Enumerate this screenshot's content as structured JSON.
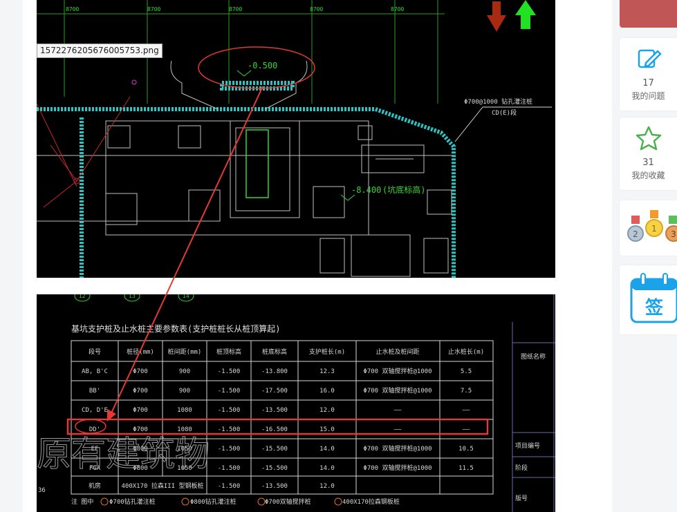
{
  "tooltip": {
    "filename": "1572276205676005753.png"
  },
  "drawing_top": {
    "axis_labels": [
      "8700",
      "8700",
      "8700",
      "8700",
      "8700"
    ],
    "elevation_1": "-0.500",
    "elevation_2": "-8.400",
    "elevation_2_note": "(坑底标高)",
    "pile_note_1": "Φ700@1000 钻孔灌注桩",
    "pile_note_2": "CD(E)段",
    "grid_tags": [
      "12",
      "13",
      "14"
    ]
  },
  "drawing_bottom": {
    "table_title": "基坑支护桩及止水桩主要参数表(支护桩桩长从桩顶算起)",
    "headers": [
      "段号",
      "桩径(mm)",
      "桩间距(mm)",
      "桩顶标高",
      "桩底标高",
      "支护桩长(m)",
      "止水桩及桩间距",
      "止水桩长(m)"
    ],
    "rows": [
      [
        "AB, B'C",
        "Φ700",
        "900",
        "-1.500",
        "-13.800",
        "12.3",
        "Φ700 双轴搅拌桩@1000",
        "5.5"
      ],
      [
        "BB'",
        "Φ700",
        "900",
        "-1.500",
        "-17.500",
        "16.0",
        "Φ700 双轴搅拌桩@1000",
        "7.5"
      ],
      [
        "CD, D'E",
        "Φ700",
        "1080",
        "-1.500",
        "-13.500",
        "12.0",
        "——",
        "——"
      ],
      [
        "DD'",
        "Φ700",
        "1080",
        "-1.500",
        "-16.500",
        "15.0",
        "——",
        "——"
      ],
      [
        "EF",
        "Φ800",
        "1050",
        "-1.500",
        "-15.500",
        "14.0",
        "Φ700 双轴搅拌桩@1000",
        "10.5"
      ],
      [
        "FGA",
        "Φ800",
        "1050",
        "-1.500",
        "-15.500",
        "14.0",
        "Φ700 双轴搅拌桩@1000",
        "11.5"
      ],
      [
        "机房",
        "400X170 拉森III 型钢板桩",
        "",
        "-1.500",
        "-13.500",
        "12.0",
        "",
        ""
      ]
    ],
    "legend_prefix": "注  图中",
    "legend_items": [
      "Φ700钻孔灌注桩",
      "Φ800钻孔灌注桩",
      "Φ700双轴搅拌桩",
      "400X170拉森钢板桩"
    ],
    "side_labels": [
      "图纸名称",
      "项目编号",
      "阶段",
      "版号"
    ],
    "row_number": "36",
    "watermark": "原有建筑物"
  },
  "sidebar": {
    "questions_count": "17",
    "questions_label": "我的问题",
    "favorites_count": "31",
    "favorites_label": "我的收藏",
    "checkin_label": "签",
    "medal_numbers": [
      "2",
      "1",
      "3"
    ]
  },
  "colors": {
    "cad_green": "#33d633",
    "cad_cyan": "#2ec3c3",
    "annotation_red": "#e53935",
    "arrow_down": "#a82a10",
    "arrow_up": "#22e022",
    "calendar_blue": "#1aa3e8",
    "star_green": "#4caf50"
  }
}
